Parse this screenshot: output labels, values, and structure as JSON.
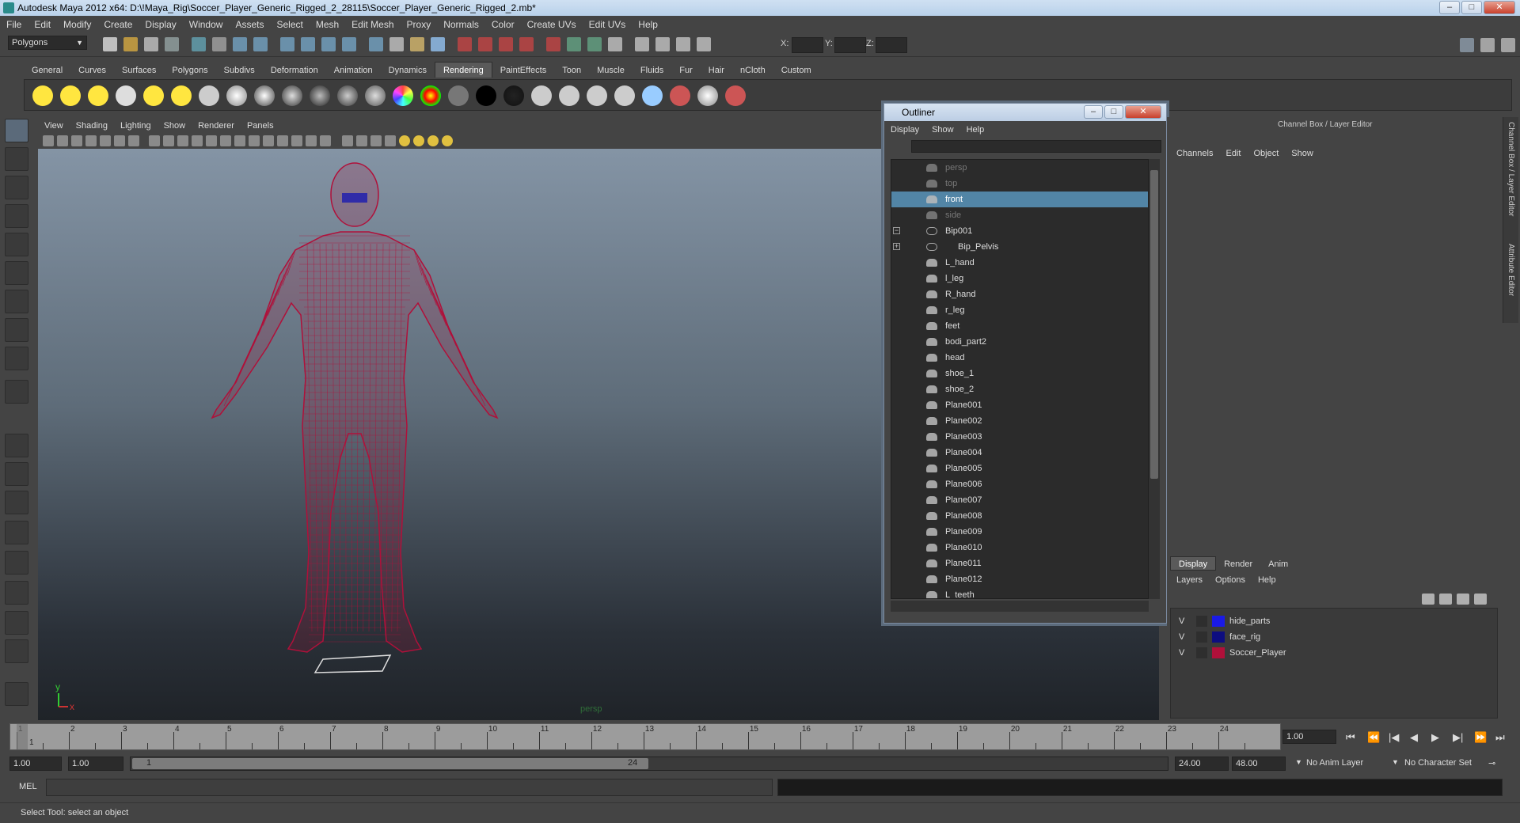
{
  "window": {
    "title": "Autodesk Maya 2012 x64: D:\\!Maya_Rig\\Soccer_Player_Generic_Rigged_2_28115\\Soccer_Player_Generic_Rigged_2.mb*",
    "controls": [
      "minimize",
      "maximize",
      "close"
    ]
  },
  "menubar": [
    "File",
    "Edit",
    "Modify",
    "Create",
    "Display",
    "Window",
    "Assets",
    "Select",
    "Mesh",
    "Edit Mesh",
    "Proxy",
    "Normals",
    "Color",
    "Create UVs",
    "Edit UVs",
    "Help"
  ],
  "statusline": {
    "mode": "Polygons",
    "x_label": "X:",
    "y_label": "Y:",
    "z_label": "Z:"
  },
  "shelf": {
    "tabs": [
      "General",
      "Curves",
      "Surfaces",
      "Polygons",
      "Subdivs",
      "Deformation",
      "Animation",
      "Dynamics",
      "Rendering",
      "PaintEffects",
      "Toon",
      "Muscle",
      "Fluids",
      "Fur",
      "Hair",
      "nCloth",
      "Custom"
    ],
    "active_tab": "Rendering"
  },
  "viewport": {
    "menu": [
      "View",
      "Shading",
      "Lighting",
      "Show",
      "Renderer",
      "Panels"
    ],
    "camera_label": "persp",
    "axis_y": "y",
    "axis_x": "x",
    "wire_color": "#b0103a"
  },
  "outliner": {
    "title": "Outliner",
    "menu": [
      "Display",
      "Show",
      "Help"
    ],
    "items": [
      {
        "label": "persp",
        "state": "dim"
      },
      {
        "label": "top",
        "state": "dim"
      },
      {
        "label": "front",
        "state": "selected"
      },
      {
        "label": "side",
        "state": "dim"
      },
      {
        "label": "Bip001",
        "state": "joint",
        "expander": "−"
      },
      {
        "label": "Bip_Pelvis",
        "state": "joint-child",
        "expander": "+"
      },
      {
        "label": "L_hand",
        "state": "normal"
      },
      {
        "label": "l_leg",
        "state": "normal"
      },
      {
        "label": "R_hand",
        "state": "normal"
      },
      {
        "label": "r_leg",
        "state": "normal"
      },
      {
        "label": "feet",
        "state": "normal"
      },
      {
        "label": "bodi_part2",
        "state": "normal"
      },
      {
        "label": "head",
        "state": "normal"
      },
      {
        "label": "shoe_1",
        "state": "normal"
      },
      {
        "label": "shoe_2",
        "state": "normal"
      },
      {
        "label": "Plane001",
        "state": "normal"
      },
      {
        "label": "Plane002",
        "state": "normal"
      },
      {
        "label": "Plane003",
        "state": "normal"
      },
      {
        "label": "Plane004",
        "state": "normal"
      },
      {
        "label": "Plane005",
        "state": "normal"
      },
      {
        "label": "Plane006",
        "state": "normal"
      },
      {
        "label": "Plane007",
        "state": "normal"
      },
      {
        "label": "Plane008",
        "state": "normal"
      },
      {
        "label": "Plane009",
        "state": "normal"
      },
      {
        "label": "Plane010",
        "state": "normal"
      },
      {
        "label": "Plane011",
        "state": "normal"
      },
      {
        "label": "Plane012",
        "state": "normal"
      },
      {
        "label": "L_teeth",
        "state": "normal"
      }
    ]
  },
  "channelbox": {
    "header": "Channel Box / Layer Editor",
    "menu": [
      "Channels",
      "Edit",
      "Object",
      "Show"
    ],
    "side_tab_1": "Channel Box / Layer Editor",
    "side_tab_2": "Attribute Editor"
  },
  "layers": {
    "tabs": [
      "Display",
      "Render",
      "Anim"
    ],
    "active_tab": "Display",
    "menu": [
      "Layers",
      "Options",
      "Help"
    ],
    "rows": [
      {
        "v": "V",
        "name": "hide_parts",
        "color": "#1a1ae6"
      },
      {
        "v": "V",
        "name": "face_rig",
        "color": "#0d0d80"
      },
      {
        "v": "V",
        "name": "Soccer_Player",
        "color": "#b0103a"
      }
    ]
  },
  "timeline": {
    "ticks": [
      "1",
      "2",
      "3",
      "4",
      "5",
      "6",
      "7",
      "8",
      "9",
      "10",
      "11",
      "12",
      "13",
      "14",
      "15",
      "16",
      "17",
      "18",
      "19",
      "20",
      "21",
      "22",
      "23",
      "24"
    ],
    "current_frame_marker": "1",
    "current_frame": "1.00",
    "playback": [
      "⏮",
      "⏪",
      "|◀",
      "◀",
      "▶",
      "▶|",
      "⏩",
      "⏭"
    ]
  },
  "range": {
    "start": "1.00",
    "playback_start": "1.00",
    "range_left": "1",
    "range_right": "24",
    "playback_end": "24.00",
    "end": "48.00",
    "anim_layer": "No Anim Layer",
    "char_set": "No Character Set"
  },
  "commandline": {
    "label": "MEL"
  },
  "helpline": {
    "text": "Select Tool: select an object"
  }
}
